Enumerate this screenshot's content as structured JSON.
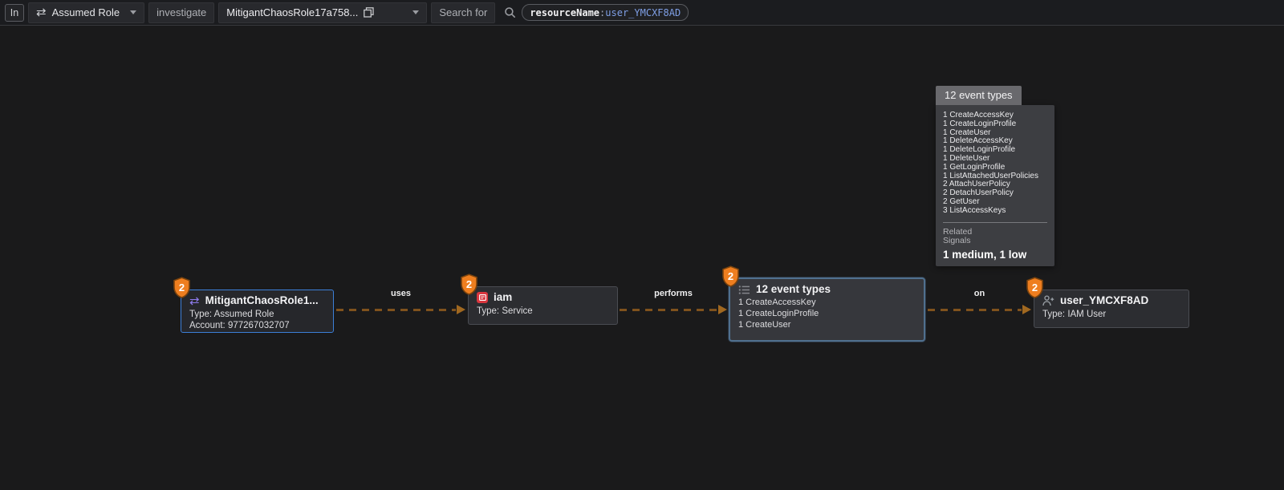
{
  "toolbar": {
    "in_label": "In",
    "entity_type_dropdown": {
      "label": "Assumed Role"
    },
    "investigate_label": "investigate",
    "entity_dropdown": {
      "label": "MitigantChaosRole17a758..."
    },
    "search_for_label": "Search for",
    "query": {
      "key": "resourceName",
      "colon": ":",
      "value": "user_YMCXF8AD"
    }
  },
  "graph": {
    "nodes": [
      {
        "title": "MitigantChaosRole1...",
        "badge": "2",
        "icon": "swap-arrows-icon",
        "lines": [
          "Type: Assumed Role",
          "Account: 977267032707"
        ]
      },
      {
        "title": "iam",
        "badge": "2",
        "icon": "aws-iam-icon",
        "lines": [
          "Type: Service"
        ]
      },
      {
        "title": "12 event types",
        "badge": "2",
        "icon": "event-list-icon",
        "lines": [
          "1 CreateAccessKey",
          "1 CreateLoginProfile",
          "1 CreateUser"
        ]
      },
      {
        "title": "user_YMCXF8AD",
        "badge": "2",
        "icon": "iam-user-icon",
        "lines": [
          "Type: IAM User"
        ]
      }
    ],
    "edges": [
      {
        "label": "uses"
      },
      {
        "label": "performs"
      },
      {
        "label": "on"
      }
    ]
  },
  "tooltip": {
    "title": "12 event types",
    "events": [
      "1 CreateAccessKey",
      "1 CreateLoginProfile",
      "1 CreateUser",
      "1 DeleteAccessKey",
      "1 DeleteLoginProfile",
      "1 DeleteUser",
      "1 GetLoginProfile",
      "1 ListAttachedUserPolicies",
      "2 AttachUserPolicy",
      "2 DetachUserPolicy",
      "2 GetUser",
      "3 ListAccessKeys"
    ],
    "related_line1": "Related",
    "related_line2": "Signals",
    "signals_summary": "1 medium, 1 low"
  },
  "colors": {
    "badge_orange": "#ee7e1f",
    "edge_dash_orange": "#80521d",
    "edge_arrow_orange": "#a06820",
    "selected_node_border_blue": "#3c7fd8",
    "hovered_node_border_blue": "#50708f",
    "query_value_blue": "#7f9fe6",
    "swap_icon_purple": "#8f7df0",
    "iam_icon_red": "#d9363e",
    "tooltip_tab_gray": "#69696d",
    "tooltip_body_gray": "#3d3e42"
  }
}
